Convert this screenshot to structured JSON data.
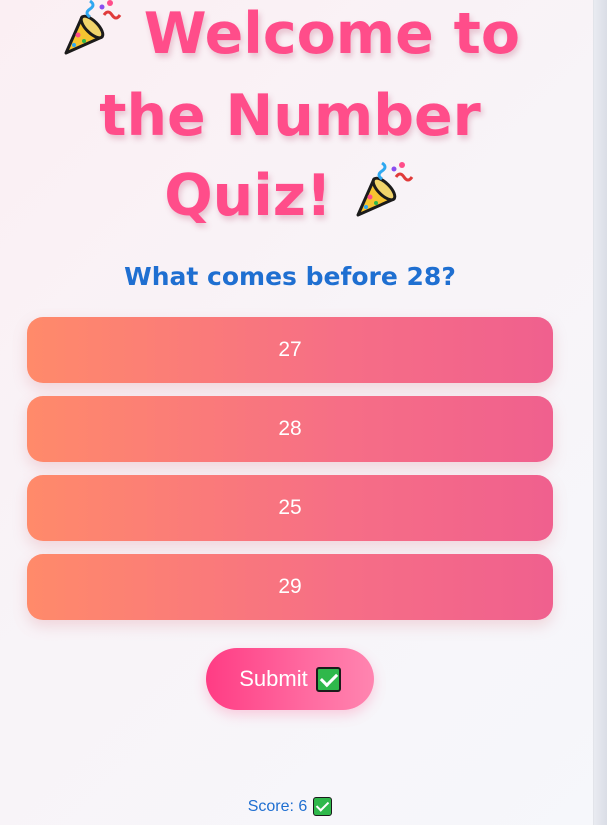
{
  "title": {
    "line1_text": "Welcome to",
    "line2_text": "the Number",
    "line3_text": "Quiz!",
    "emoji_icon": "party-popper-icon"
  },
  "question": "What comes before 28?",
  "options": [
    "27",
    "28",
    "25",
    "29"
  ],
  "submit": {
    "label": "Submit",
    "icon": "check-mark-button-icon"
  },
  "score": {
    "label": "Score: 6",
    "icon": "check-mark-button-icon"
  },
  "colors": {
    "title": "#ff4d8a",
    "question": "#1f6fd1",
    "option_start": "#ff8a6a",
    "option_end": "#f0608e",
    "submit": "#ff3c84",
    "check": "#2fb84b"
  }
}
